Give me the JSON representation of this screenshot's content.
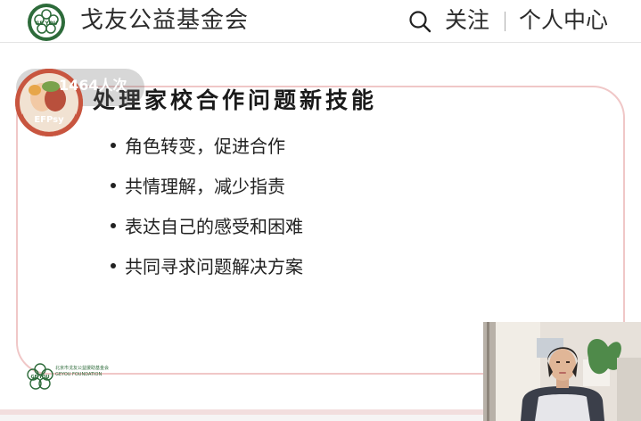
{
  "header": {
    "org_name": "戈友公益基金会",
    "logo_icon": "gefoundation-logo-icon",
    "logo_text": "GE YOU",
    "search_icon": "search-icon",
    "follow_label": "关注",
    "profile_label": "个人中心"
  },
  "live": {
    "viewer_count": "1464人次",
    "avatar_text": "EFPsy"
  },
  "slide": {
    "title": "处理家校合作问题新技能",
    "bullets": [
      "角色转变，促进合作",
      "共情理解，减少指责",
      "表达自己的感受和困难",
      "共同寻求问题解决方案"
    ],
    "footer_logo_text": "GE YOU",
    "footer_org_cn": "北京市戈友公益援助基金会",
    "footer_org_en": "GEYOU FOUNDATION"
  },
  "colors": {
    "slide_border": "#f0c7c7",
    "logo_green": "#2d6b3a",
    "avatar_red": "#c8553f"
  }
}
